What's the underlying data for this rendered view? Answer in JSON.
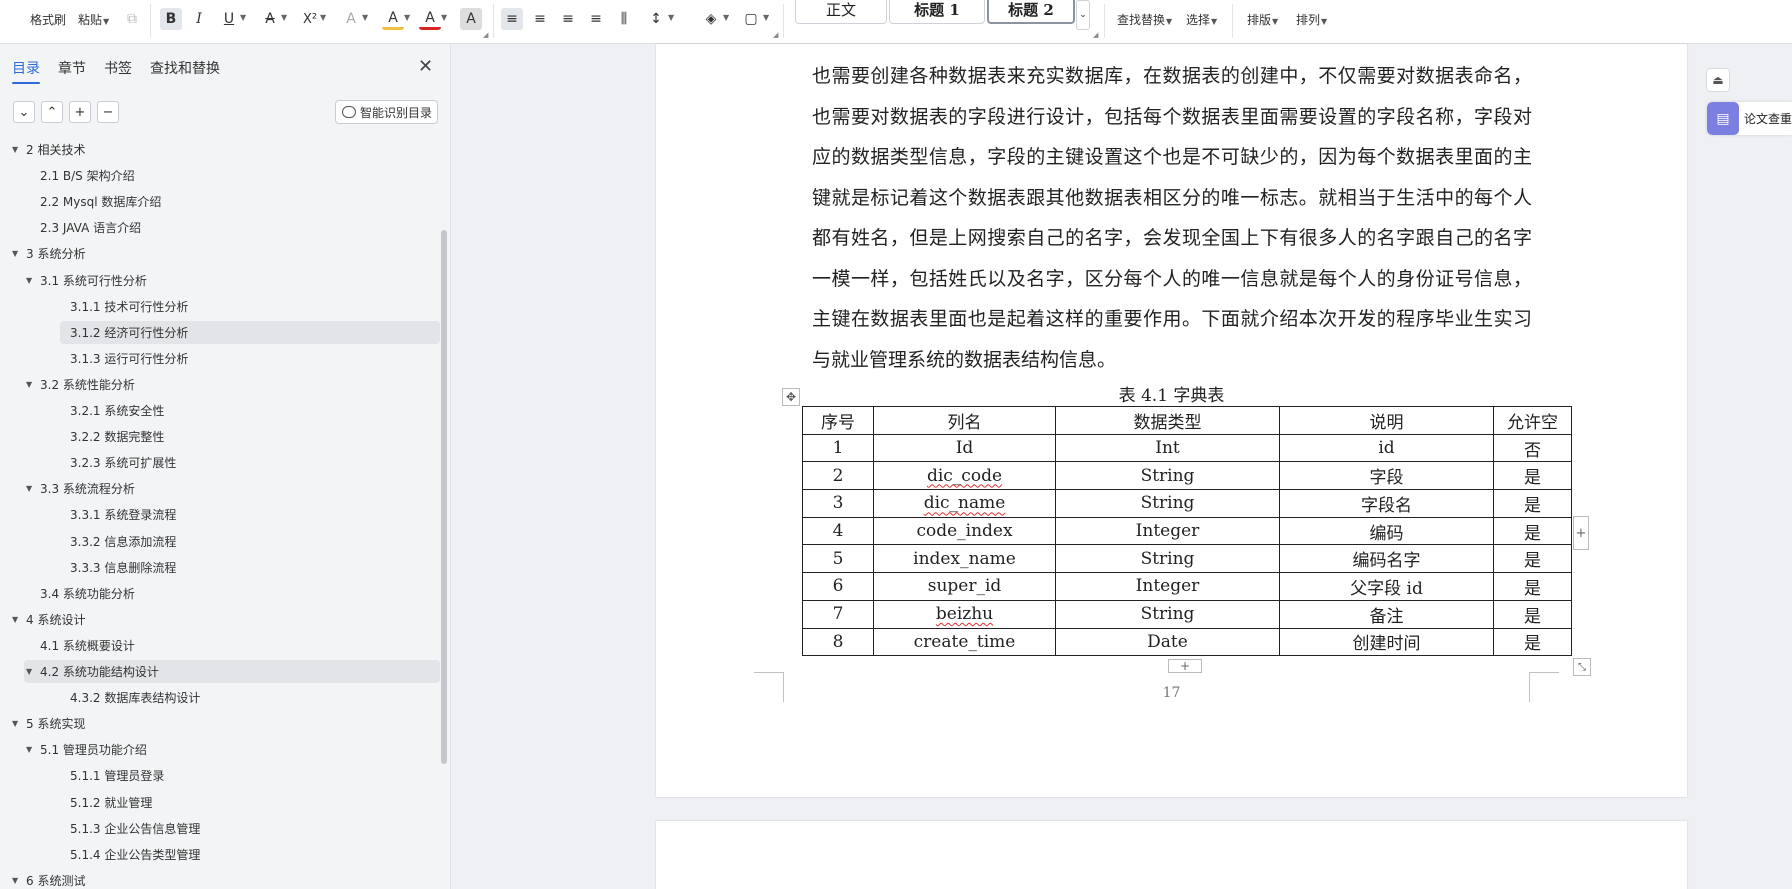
{
  "toolbar": {
    "format_painter": "格式刷",
    "paste": "粘贴",
    "font_buttons": {
      "bold": "B",
      "italic": "I",
      "underline": "U",
      "strike": "A",
      "superscript": "X²",
      "text_effect": "A",
      "highlight": "A",
      "font_color": "A",
      "char_shading": "A"
    },
    "styles": [
      "正文",
      "标题 1",
      "标题 2"
    ],
    "find_replace": "查找替换",
    "select": "选择",
    "layout": "排版",
    "arrange": "排列"
  },
  "nav": {
    "tabs": [
      "目录",
      "章节",
      "书签",
      "查找和替换"
    ],
    "active_tab": "目录",
    "smart_toc": "智能识别目录",
    "toc": [
      {
        "label": "2  相关技术",
        "level": 1,
        "caret": true
      },
      {
        "label": "2.1 B/S 架构介绍",
        "level": 2
      },
      {
        "label": "2.2 Mysql 数据库介绍",
        "level": 2
      },
      {
        "label": "2.3 JAVA 语言介绍",
        "level": 2
      },
      {
        "label": "3  系统分析",
        "level": 1,
        "caret": true
      },
      {
        "label": "3.1 系统可行性分析",
        "level": 2,
        "caret": true
      },
      {
        "label": "3.1.1  技术可行性分析",
        "level": 3
      },
      {
        "label": "3.1.2  经济可行性分析",
        "level": 3,
        "selected": true
      },
      {
        "label": "3.1.3  运行可行性分析",
        "level": 3
      },
      {
        "label": "3.2 系统性能分析",
        "level": 2,
        "caret": true
      },
      {
        "label": "3.2.1  系统安全性",
        "level": 3
      },
      {
        "label": "3.2.2  数据完整性",
        "level": 3
      },
      {
        "label": "3.2.3 系统可扩展性",
        "level": 3
      },
      {
        "label": "3.3 系统流程分析",
        "level": 2,
        "caret": true
      },
      {
        "label": "3.3.1 系统登录流程",
        "level": 3
      },
      {
        "label": "3.3.2 信息添加流程",
        "level": 3
      },
      {
        "label": "3.3.3 信息删除流程",
        "level": 3
      },
      {
        "label": "3.4 系统功能分析",
        "level": 2
      },
      {
        "label": "4  系统设计",
        "level": 1,
        "caret": true
      },
      {
        "label": "4.1 系统概要设计",
        "level": 2
      },
      {
        "label": "4.2 系统功能结构设计",
        "level": 2,
        "caret": true,
        "selected": true
      },
      {
        "label": "4.3.2  数据库表结构设计",
        "level": 3
      },
      {
        "label": "5  系统实现",
        "level": 1,
        "caret": true
      },
      {
        "label": "5.1 管理员功能介绍",
        "level": 2,
        "caret": true
      },
      {
        "label": "5.1.1 管理员登录",
        "level": 3
      },
      {
        "label": "5.1.2  就业管理",
        "level": 3
      },
      {
        "label": "5.1.3  企业公告信息管理",
        "level": 3
      },
      {
        "label": "5.1.4 企业公告类型管理",
        "level": 3
      },
      {
        "label": "6 系统测试",
        "level": 1,
        "caret": true
      }
    ]
  },
  "document": {
    "paragraph": "也需要创建各种数据表来充实数据库，在数据表的创建中，不仅需要对数据表命名，也需要对数据表的字段进行设计，包括每个数据表里面需要设置的字段名称，字段对应的数据类型信息，字段的主键设置这个也是不可缺少的，因为每个数据表里面的主键就是标记着这个数据表跟其他数据表相区分的唯一标志。就相当于生活中的每个人都有姓名，但是上网搜索自己的名字，会发现全国上下有很多人的名字跟自己的名字一模一样，包括姓氏以及名字，区分每个人的唯一信息就是每个人的身份证号信息，主键在数据表里面也是起着这样的重要作用。下面就介绍本次开发的程序毕业生实习与就业管理系统的数据表结构信息。",
    "table_caption": "表 4.1 字典表",
    "table": {
      "headers": [
        "序号",
        "列名",
        "数据类型",
        "说明",
        "允许空"
      ],
      "rows": [
        [
          "1",
          "Id",
          "Int",
          "id",
          "否"
        ],
        [
          "2",
          "dic_code",
          "String",
          "字段",
          "是"
        ],
        [
          "3",
          "dic_name",
          "String",
          "字段名",
          "是"
        ],
        [
          "4",
          "code_index",
          "Integer",
          "编码",
          "是"
        ],
        [
          "5",
          "index_name",
          "String",
          "编码名字",
          "是"
        ],
        [
          "6",
          "super_id",
          "Integer",
          "父字段 id",
          "是"
        ],
        [
          "7",
          "beizhu",
          "String",
          "备注",
          "是"
        ],
        [
          "8",
          "create_time",
          "Date",
          "创建时间",
          "是"
        ]
      ]
    },
    "page_number": "17"
  },
  "right_panel": {
    "paper_check": "论文查重"
  }
}
